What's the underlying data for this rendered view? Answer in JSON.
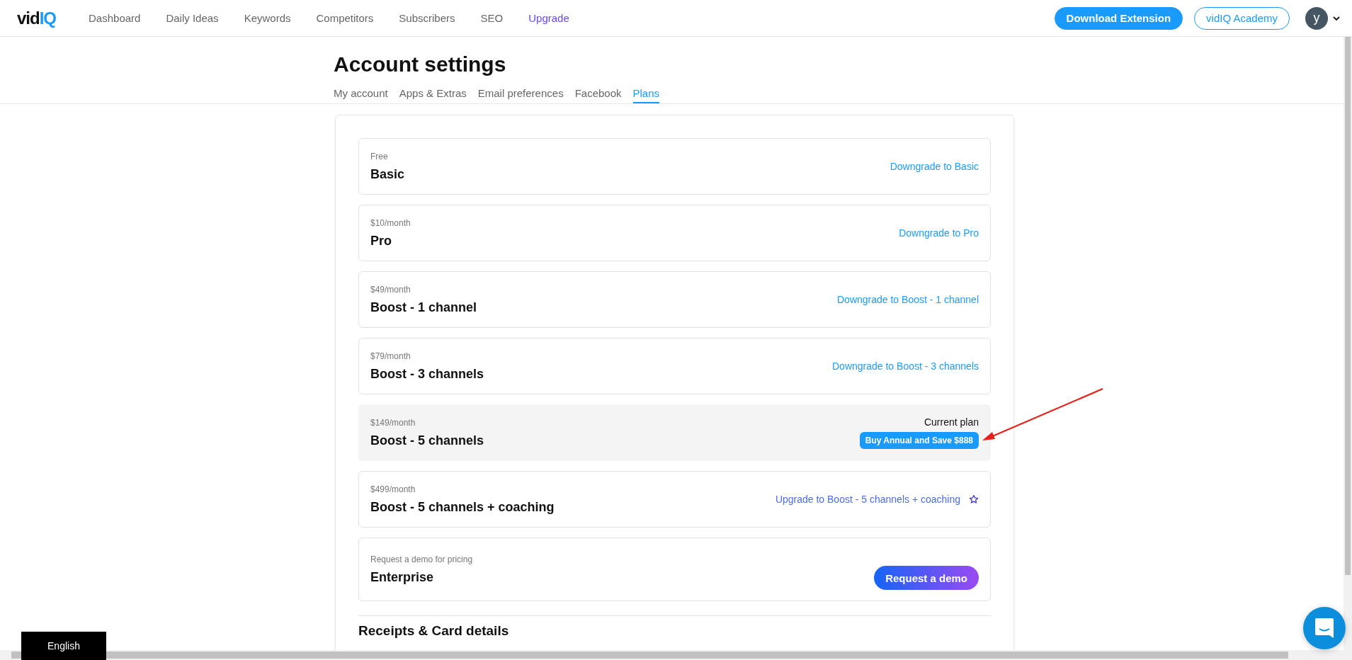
{
  "nav": {
    "logo": {
      "lead": "vid",
      "accent": "IQ"
    },
    "links": [
      {
        "label": "Dashboard",
        "kind": "link"
      },
      {
        "label": "Daily Ideas",
        "kind": "link"
      },
      {
        "label": "Keywords",
        "kind": "link"
      },
      {
        "label": "Competitors",
        "kind": "link"
      },
      {
        "label": "Subscribers",
        "kind": "link"
      },
      {
        "label": "SEO",
        "kind": "link"
      },
      {
        "label": "Upgrade",
        "kind": "upgrade"
      }
    ],
    "buttons": [
      {
        "label": "Download Extension",
        "kind": "filled"
      },
      {
        "label": "vidIQ Academy",
        "kind": "outline"
      }
    ],
    "avatar": "y"
  },
  "page_title": "Account settings",
  "tabs": [
    {
      "label": "My account",
      "selected": false
    },
    {
      "label": "Apps & Extras",
      "selected": false
    },
    {
      "label": "Email preferences",
      "selected": false
    },
    {
      "label": "Facebook",
      "selected": false
    },
    {
      "label": "Plans",
      "selected": true
    }
  ],
  "plans": [
    {
      "price": "Free",
      "name": "Basic",
      "kind": "downgrade",
      "action": "Downgrade to Basic"
    },
    {
      "price": "$10/month",
      "name": "Pro",
      "kind": "downgrade",
      "action": "Downgrade to Pro"
    },
    {
      "price": "$49/month",
      "name": "Boost - 1 channel",
      "kind": "downgrade",
      "action": "Downgrade to Boost - 1 channel"
    },
    {
      "price": "$79/month",
      "name": "Boost - 3 channels",
      "kind": "downgrade",
      "action": "Downgrade to Boost - 3 channels"
    },
    {
      "price": "$149/month",
      "name": "Boost - 5 channels",
      "kind": "current",
      "status": "Current plan",
      "action": "Buy Annual and Save $888"
    },
    {
      "price": "$499/month",
      "name": "Boost - 5 channels + coaching",
      "kind": "upgrade",
      "action": "Upgrade to Boost - 5 channels + coaching"
    },
    {
      "price": "Request a demo for pricing",
      "name": "Enterprise",
      "kind": "demo",
      "action": "Request a demo"
    }
  ],
  "section_heading": "Receipts & Card details",
  "language": "English"
}
